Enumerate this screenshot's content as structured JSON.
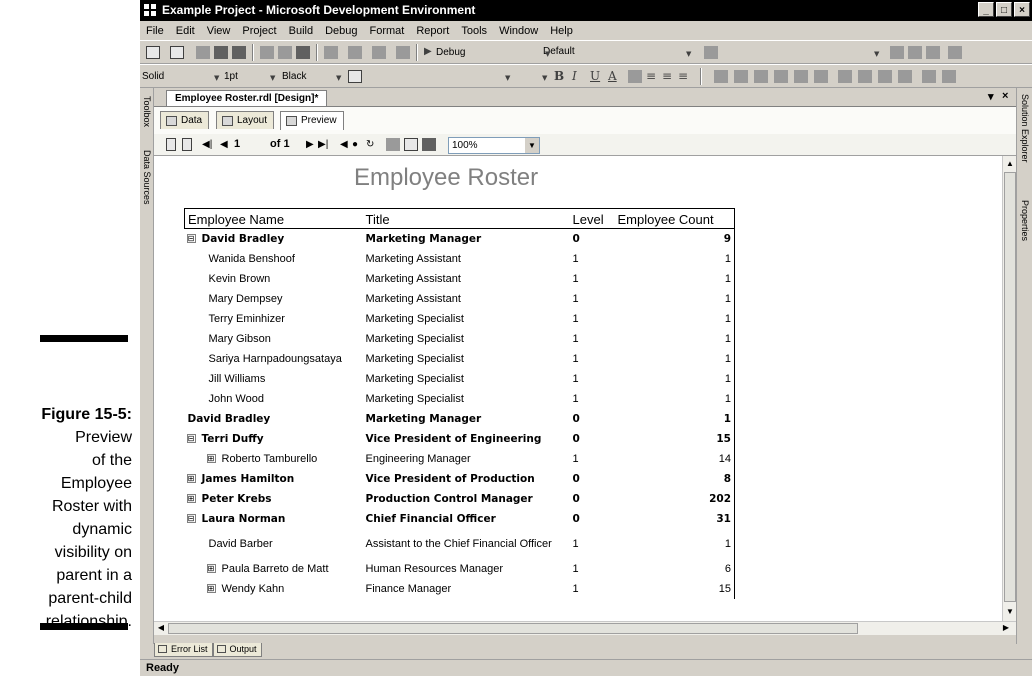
{
  "caption": {
    "figure_label": "Figure 15-5:",
    "lines": [
      "Preview",
      "of the",
      "Employee",
      "Roster with",
      "dynamic",
      "visibility on",
      "parent in a",
      "parent-child",
      "relationship."
    ]
  },
  "window": {
    "title": "Example Project - Microsoft Development Environment",
    "controls": [
      "_",
      "□",
      "×"
    ]
  },
  "menu": [
    "File",
    "Edit",
    "View",
    "Project",
    "Build",
    "Debug",
    "Format",
    "Report",
    "Tools",
    "Window",
    "Help"
  ],
  "toolbar": {
    "config": "Debug",
    "platform": "Default",
    "border_style": "Solid",
    "border_width": "1pt",
    "border_color": "Black"
  },
  "side_tabs": {
    "left": [
      "Toolbox",
      "Data Sources"
    ],
    "right": [
      "Solution Explorer",
      "Properties"
    ]
  },
  "document_tab": "Employee Roster.rdl [Design]*",
  "design_tabs": [
    "Data",
    "Layout",
    "Preview"
  ],
  "preview_toolbar": {
    "page": "1",
    "of_pages": "of 1",
    "zoom": "100%"
  },
  "report": {
    "title": "Employee Roster",
    "columns": [
      "Employee Name",
      "Title",
      "Level",
      "Employee Count"
    ],
    "rows": [
      {
        "name": "David Bradley",
        "title": "Marketing Manager",
        "level": "0",
        "count": "9",
        "bold": true,
        "toggle": "⊟",
        "indent": 0
      },
      {
        "name": "Wanida Benshoof",
        "title": "Marketing Assistant",
        "level": "1",
        "count": "1",
        "bold": false,
        "toggle": "",
        "indent": 1
      },
      {
        "name": "Kevin Brown",
        "title": "Marketing Assistant",
        "level": "1",
        "count": "1",
        "bold": false,
        "toggle": "",
        "indent": 1
      },
      {
        "name": "Mary Dempsey",
        "title": "Marketing Assistant",
        "level": "1",
        "count": "1",
        "bold": false,
        "toggle": "",
        "indent": 1
      },
      {
        "name": "Terry Eminhizer",
        "title": "Marketing Specialist",
        "level": "1",
        "count": "1",
        "bold": false,
        "toggle": "",
        "indent": 1
      },
      {
        "name": "Mary Gibson",
        "title": "Marketing Specialist",
        "level": "1",
        "count": "1",
        "bold": false,
        "toggle": "",
        "indent": 1
      },
      {
        "name": "Sariya Harnpadoungsataya",
        "title": "Marketing Specialist",
        "level": "1",
        "count": "1",
        "bold": false,
        "toggle": "",
        "indent": 1
      },
      {
        "name": "Jill Williams",
        "title": "Marketing Specialist",
        "level": "1",
        "count": "1",
        "bold": false,
        "toggle": "",
        "indent": 1
      },
      {
        "name": "John Wood",
        "title": "Marketing Specialist",
        "level": "1",
        "count": "1",
        "bold": false,
        "toggle": "",
        "indent": 1
      },
      {
        "name": "David Bradley",
        "title": "Marketing Manager",
        "level": "0",
        "count": "1",
        "bold": true,
        "toggle": "",
        "indent": 0
      },
      {
        "name": "Terri Duffy",
        "title": "Vice President of Engineering",
        "level": "0",
        "count": "15",
        "bold": true,
        "toggle": "⊟",
        "indent": 0
      },
      {
        "name": "Roberto Tamburello",
        "title": "Engineering Manager",
        "level": "1",
        "count": "14",
        "bold": false,
        "toggle": "⊞",
        "indent": 1
      },
      {
        "name": "James Hamilton",
        "title": "Vice President of Production",
        "level": "0",
        "count": "8",
        "bold": true,
        "toggle": "⊞",
        "indent": 0
      },
      {
        "name": "Peter Krebs",
        "title": "Production Control Manager",
        "level": "0",
        "count": "202",
        "bold": true,
        "toggle": "⊞",
        "indent": 0
      },
      {
        "name": "Laura Norman",
        "title": "Chief Financial Officer",
        "level": "0",
        "count": "31",
        "bold": true,
        "toggle": "⊟",
        "indent": 0
      },
      {
        "name": "David Barber",
        "title": "Assistant to the Chief Financial Officer",
        "level": "1",
        "count": "1",
        "bold": false,
        "toggle": "",
        "indent": 1
      },
      {
        "name": "Paula Barreto de Matt",
        "title": "Human Resources Manager",
        "level": "1",
        "count": "6",
        "bold": false,
        "toggle": "⊞",
        "indent": 1
      },
      {
        "name": "Wendy Kahn",
        "title": "Finance Manager",
        "level": "1",
        "count": "15",
        "bold": false,
        "toggle": "⊞",
        "indent": 1
      }
    ]
  },
  "bottom_tabs": [
    "Error List",
    "Output"
  ],
  "status": "Ready",
  "colors": {
    "chrome": "#d4d0c8",
    "title_bar": "#000000",
    "report_title": "#808080"
  },
  "icons": [
    "app-icon",
    "new-project-icon",
    "open-icon",
    "save-icon",
    "cut-icon",
    "copy-icon",
    "paste-icon",
    "undo-icon",
    "redo-icon",
    "start-icon",
    "print-icon",
    "zoom-combo"
  ]
}
